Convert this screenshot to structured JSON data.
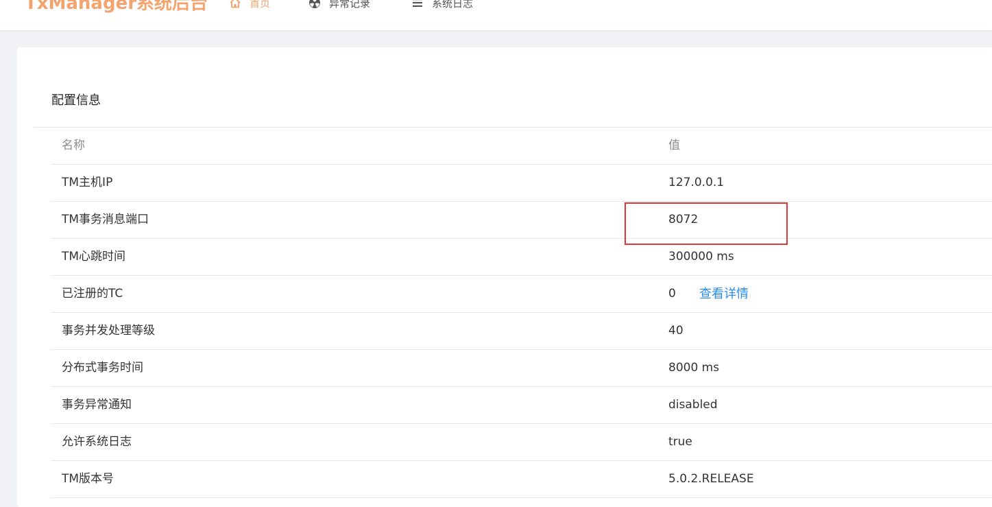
{
  "header": {
    "logo": "TxManager系统后台",
    "nav": [
      {
        "label": "首页",
        "icon": "home-icon"
      },
      {
        "label": "异常记录",
        "icon": "radiation-icon"
      },
      {
        "label": "系统日志",
        "icon": "list-icon"
      }
    ]
  },
  "card": {
    "title": "配置信息"
  },
  "table": {
    "headers": {
      "name": "名称",
      "value": "值"
    },
    "rows": [
      {
        "name": "TM主机IP",
        "value": "127.0.0.1"
      },
      {
        "name": "TM事务消息端口",
        "value": "8072"
      },
      {
        "name": "TM心跳时间",
        "value": "300000 ms"
      },
      {
        "name": "已注册的TC",
        "value": "0",
        "link": "查看详情"
      },
      {
        "name": "事务并发处理等级",
        "value": "40"
      },
      {
        "name": "分布式事务时间",
        "value": "8000 ms"
      },
      {
        "name": "事务异常通知",
        "value": "disabled"
      },
      {
        "name": "允许系统日志",
        "value": "true"
      },
      {
        "name": "TM版本号",
        "value": "5.0.2.RELEASE"
      }
    ]
  },
  "colors": {
    "accent": "#f2a36e",
    "link": "#2d8cf0",
    "highlight": "#e0363a"
  }
}
